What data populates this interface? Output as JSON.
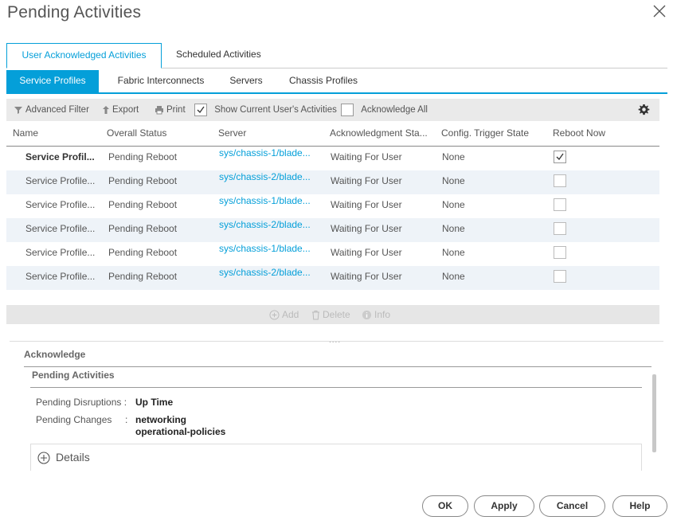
{
  "dialog": {
    "title": "Pending Activities"
  },
  "top_tabs": [
    "User Acknowledged Activities",
    "Scheduled Activities"
  ],
  "sub_tabs": [
    "Service Profiles",
    "Fabric Interconnects",
    "Servers",
    "Chassis Profiles"
  ],
  "toolbar": {
    "advanced_filter": "Advanced Filter",
    "export": "Export",
    "print": "Print",
    "show_current_user": "Show Current User's Activities",
    "show_current_user_checked": true,
    "acknowledge_all": "Acknowledge All",
    "acknowledge_all_checked": false
  },
  "table": {
    "columns": [
      "Name",
      "Overall Status",
      "Server",
      "Acknowledgment Sta...",
      "Config. Trigger State",
      "Reboot Now"
    ],
    "rows": [
      {
        "name": "Service Profil...",
        "status": "Pending Reboot",
        "server": "sys/chassis-1/blade...",
        "ack": "Waiting For User",
        "trigger": "None",
        "reboot": true
      },
      {
        "name": "Service Profile...",
        "status": "Pending Reboot",
        "server": "sys/chassis-2/blade...",
        "ack": "Waiting For User",
        "trigger": "None",
        "reboot": false
      },
      {
        "name": "Service Profile...",
        "status": "Pending Reboot",
        "server": "sys/chassis-1/blade...",
        "ack": "Waiting For User",
        "trigger": "None",
        "reboot": false
      },
      {
        "name": "Service Profile...",
        "status": "Pending Reboot",
        "server": "sys/chassis-2/blade...",
        "ack": "Waiting For User",
        "trigger": "None",
        "reboot": false
      },
      {
        "name": "Service Profile...",
        "status": "Pending Reboot",
        "server": "sys/chassis-1/blade...",
        "ack": "Waiting For User",
        "trigger": "None",
        "reboot": false
      },
      {
        "name": "Service Profile...",
        "status": "Pending Reboot",
        "server": "sys/chassis-2/blade...",
        "ack": "Waiting For User",
        "trigger": "None",
        "reboot": false
      }
    ]
  },
  "actions": {
    "add": "Add",
    "delete": "Delete",
    "info": "Info"
  },
  "grip": "....",
  "acknowledge": {
    "section_title": "Acknowledge",
    "subsection_title": "Pending Activities",
    "disruptions_label": "Pending Disruptions :",
    "disruptions_value": "Up Time",
    "changes_label": "Pending Changes",
    "changes_colon": ":",
    "changes_values": [
      "networking",
      "operational-policies"
    ],
    "details": "Details"
  },
  "buttons": {
    "ok": "OK",
    "apply": "Apply",
    "cancel": "Cancel",
    "help": "Help"
  },
  "colors": {
    "accent": "#049fd9",
    "row_alt": "#eef3f8"
  }
}
